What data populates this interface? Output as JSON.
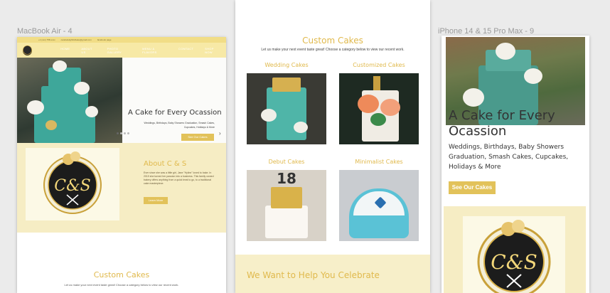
{
  "frames": {
    "macbook_label": "MacBook Air - 4",
    "iphone_label": "iPhone 14 & 15 Pro Max - 9"
  },
  "macbook": {
    "topbar": {
      "phone": "+1 (xxx) 758-xxxx",
      "email": "candsdelightfulbake@gmail.com",
      "social": "facebook page"
    },
    "nav": [
      "HOME",
      "ABOUT US",
      "PHOTO GALLERY",
      "MENU & FLAVORS",
      "CONTACT",
      "SHOP NOW"
    ],
    "hero": {
      "title": "A Cake for Every Ocassion",
      "subtitle": "Weddings, Birthdays, Baby Showers Graduation, Smash Cakes, Cupcakes, Holidays & More",
      "button": "See Our Cakes",
      "arrow": "›"
    },
    "about": {
      "title": "About C & S",
      "text": "Ever since she was a little girl, Jane \"Hylinn\" loved to bake. In 2019 she turned her passion into a business. This family owned bakery offers anything from a quick treat to go, to a traditional cake masterpiece.",
      "button": "Learn More"
    },
    "custom_cakes": {
      "title": "Custom Cakes",
      "subtitle": "Let us make your next event taste great! Choose a category below to view our recent work."
    }
  },
  "middle": {
    "title": "Custom Cakes",
    "subtitle": "Let us make your next event taste great! Choose a category below to view our recent work.",
    "categories": [
      "Wedding Cakes",
      "Customized Cakes",
      "Debut Cakes",
      "Minimalist Cakes"
    ],
    "debut_number": "18",
    "help_title": "We Want to Help You Celebrate"
  },
  "iphone": {
    "hero_title": "A Cake for Every Ocassion",
    "hero_subtitle": "Weddings, Birthdays, Baby Showers Graduation, Smash Cakes, Cupcakes, Holidays & More",
    "button": "See Our Cakes"
  },
  "colors": {
    "gold": "#e0b94c",
    "button": "#e2c25a",
    "cream": "#f6edc4",
    "nav": "#f7e9a6"
  }
}
